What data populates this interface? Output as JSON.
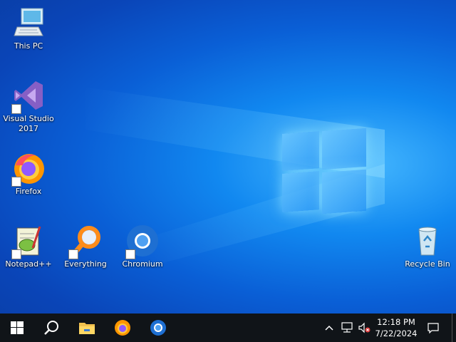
{
  "desktop": {
    "icons": [
      {
        "label": "This PC"
      },
      {
        "label": "Visual Studio 2017"
      },
      {
        "label": "Firefox"
      },
      {
        "label": "Notepad++"
      },
      {
        "label": "Everything"
      },
      {
        "label": "Chromium"
      },
      {
        "label": "Recycle Bin"
      }
    ]
  },
  "taskbar": {
    "pinned": [
      "start-icon",
      "search-icon",
      "file-explorer-icon",
      "firefox-icon",
      "chromium-icon"
    ],
    "clock": {
      "time": "12:18 PM",
      "date": "7/22/2024"
    }
  },
  "colors": {
    "taskbar": "#101418",
    "accent": "#0a5fd6"
  }
}
